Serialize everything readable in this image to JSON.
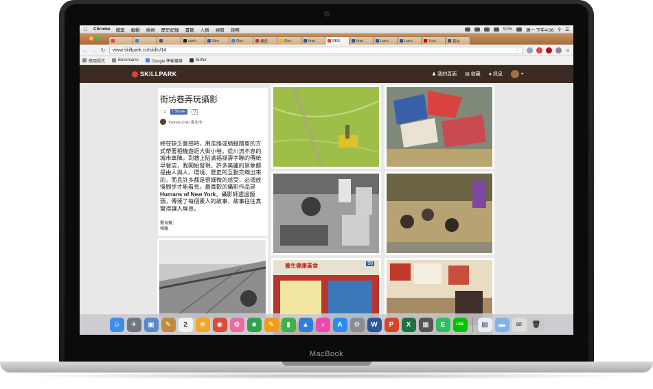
{
  "device": {
    "brand": "MacBook"
  },
  "menubar": {
    "app_name": "Chrome",
    "items": [
      "檔案",
      "編輯",
      "檢視",
      "歷史紀錄",
      "書籤",
      "人員",
      "視窗",
      "說明"
    ],
    "battery": "91%",
    "clock": "週一 下午4:06"
  },
  "tabs": [
    {
      "label": "",
      "color": "#ea4335"
    },
    {
      "label": "",
      "color": "#4a7bd0"
    },
    {
      "label": "",
      "color": "#555555"
    },
    {
      "label": "canh",
      "color": "#222222"
    },
    {
      "label": "Stre",
      "color": "#3b5998"
    },
    {
      "label": "Goo",
      "color": "#4285f4"
    },
    {
      "label": "楓良",
      "color": "#c0392b"
    },
    {
      "label": "Goo",
      "color": "#f4b400"
    },
    {
      "label": "final",
      "color": "#2b579a"
    },
    {
      "label": "SKIL",
      "color": "#e0433a",
      "active": true
    },
    {
      "label": "final",
      "color": "#2b579a"
    },
    {
      "label": "Lanc",
      "color": "#2b579a"
    },
    {
      "label": "Lanc",
      "color": "#2b579a"
    },
    {
      "label": "Yout",
      "color": "#cc0000"
    },
    {
      "label": "我在",
      "color": "#555555"
    }
  ],
  "address": {
    "url": "www.skillpark.co/skills/14"
  },
  "bookmarks": [
    "應用程式",
    "Bookmarks",
    "Google 準衡獲尊",
    "Buffer"
  ],
  "site": {
    "logo": "SKILLPARK",
    "nav": {
      "profile": "我的頁面",
      "favorites": "收藏",
      "messages": "訊息"
    }
  },
  "skill": {
    "title": "街坊巷弄玩攝影",
    "likes": "♡1",
    "share_label": "Share",
    "share_count": "0",
    "author": "Yvonne Chiu 會北市",
    "description_parts": [
      "總在缺乏靈感時，用走路或騎腳踏車的方式帶著相機遊逛大街小巷。從川流不息的城市車陣，到牆上貼滿福祿壽字聯的傳統早餐店，我開始發現，許多美麗的景象都是由人與人、環境、歷史的互動交織出來的，而且許多都是很細微的感受，必須放慢腳步才能看見。最喜歡的攝影作品是",
      "Humans of New York",
      "，攝影師透過鏡頭，傳達了每個素人的故事，故事往往真實得讓人屏息。"
    ],
    "gear_label": "需自備：",
    "gear_value": "相機"
  },
  "photos": [
    {
      "desc": "field-aerial"
    },
    {
      "desc": "market-tents"
    },
    {
      "desc": "parking-bw"
    },
    {
      "desc": "crowd-aerial"
    },
    {
      "desc": "bridge-bw"
    },
    {
      "desc": "shop-front"
    },
    {
      "desc": "shop-interior"
    }
  ],
  "shop_sign": "養生健康素食",
  "shop_number": "58",
  "dock": [
    {
      "name": "finder",
      "color": "#3d8ee6",
      "glyph": "☺"
    },
    {
      "name": "launchpad",
      "color": "#6f7781",
      "glyph": "✈"
    },
    {
      "name": "preview",
      "color": "#5b88c9",
      "glyph": "▣"
    },
    {
      "name": "notes",
      "color": "#c28a3e",
      "glyph": "✎"
    },
    {
      "name": "calendar",
      "color": "#f2f2f2",
      "glyph": "2"
    },
    {
      "name": "photos",
      "color": "#f6a623",
      "glyph": "❀"
    },
    {
      "name": "chrome",
      "color": "#dd4b39",
      "glyph": "◉"
    },
    {
      "name": "photos2",
      "color": "#e66fa0",
      "glyph": "✿"
    },
    {
      "name": "facetime",
      "color": "#2ea44f",
      "glyph": "■"
    },
    {
      "name": "pages",
      "color": "#f39c12",
      "glyph": "✎"
    },
    {
      "name": "numbers",
      "color": "#3bb34a",
      "glyph": "▮"
    },
    {
      "name": "keynote",
      "color": "#2f7ed8",
      "glyph": "▲"
    },
    {
      "name": "itunes",
      "color": "#e94bb0",
      "glyph": "♪"
    },
    {
      "name": "appstore",
      "color": "#2a8cf0",
      "glyph": "A"
    },
    {
      "name": "settings",
      "color": "#8a8d91",
      "glyph": "⚙"
    },
    {
      "name": "word",
      "color": "#2b579a",
      "glyph": "W"
    },
    {
      "name": "powerpoint",
      "color": "#d24726",
      "glyph": "P"
    },
    {
      "name": "excel",
      "color": "#1e7145",
      "glyph": "X"
    },
    {
      "name": "calculator",
      "color": "#555555",
      "glyph": "▦"
    },
    {
      "name": "evernote",
      "color": "#2dbe60",
      "glyph": "E"
    },
    {
      "name": "line",
      "color": "#00c300",
      "glyph": "LINE"
    },
    {
      "name": "document",
      "color": "#e8eef7",
      "glyph": "▤"
    },
    {
      "name": "folder",
      "color": "#7fb3e8",
      "glyph": "▬"
    },
    {
      "name": "downloads",
      "color": "#dcdcdc",
      "glyph": "✉"
    },
    {
      "name": "trash",
      "color": "#c8c8c8",
      "glyph": "🗑"
    }
  ]
}
